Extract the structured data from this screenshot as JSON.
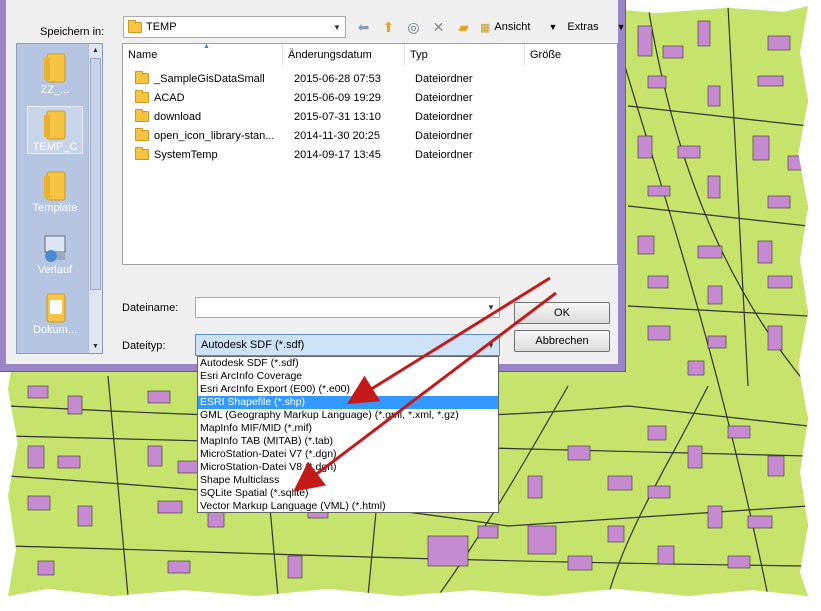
{
  "dialog": {
    "look_in_label": "Speichern in:",
    "look_in_value": "TEMP",
    "toolbar": {
      "back_icon": "back-arrow-icon",
      "up_icon": "up-folder-icon",
      "web_icon": "search-web-icon",
      "delete_icon": "delete-icon",
      "new_folder_icon": "new-folder-icon",
      "view_label": "Ansicht",
      "extras_label": "Extras"
    },
    "places": [
      {
        "label": "ZZ_..."
      },
      {
        "label": "TEMP_C"
      },
      {
        "label": "Template"
      },
      {
        "label": "Verlauf"
      },
      {
        "label": "Dokum..."
      }
    ],
    "columns": [
      "Name",
      "Änderungsdatum",
      "Typ",
      "Größe"
    ],
    "files": [
      {
        "name": "_SampleGisDataSmall",
        "date": "2015-06-28 07:53",
        "type": "Dateiordner",
        "size": ""
      },
      {
        "name": "ACAD",
        "date": "2015-06-09 19:29",
        "type": "Dateiordner",
        "size": ""
      },
      {
        "name": "download",
        "date": "2015-07-31 13:10",
        "type": "Dateiordner",
        "size": ""
      },
      {
        "name": "open_icon_library-stan...",
        "date": "2014-11-30 20:25",
        "type": "Dateiordner",
        "size": ""
      },
      {
        "name": "SystemTemp",
        "date": "2014-09-17 13:45",
        "type": "Dateiordner",
        "size": ""
      }
    ],
    "filename_label": "Dateiname:",
    "filename_value": "",
    "filetype_label": "Dateityp:",
    "filetype_value": "Autodesk SDF (*.sdf)",
    "ok_label": "OK",
    "cancel_label": "Abbrechen"
  },
  "filetype_options": [
    "Autodesk SDF (*.sdf)",
    "Esri ArcInfo Coverage",
    "Esri ArcInfo Export (E00) (*.e00)",
    "ESRI Shapefile (*.shp)",
    "GML (Geography Markup Language) (*.gml, *.xml, *.gz)",
    "MapInfo MIF/MID (*.mif)",
    "MapInfo TAB (MITAB) (*.tab)",
    "MicroStation-Datei V7 (*.dgn)",
    "MicroStation-Datei V8 (*.dgn)",
    "Shape Multiclass",
    "SQLite Spatial (*.sqlite)",
    "Vector Markup Language (VML) (*.html)"
  ],
  "selected_option_index": 3,
  "colors": {
    "map_background": "#c6e36b",
    "buildings": "#c58ad0",
    "streets": "#3a3a3a",
    "window_frame": "#9a86c6",
    "selection": "#3399ff",
    "annotation_arrow": "#c41a1a"
  }
}
